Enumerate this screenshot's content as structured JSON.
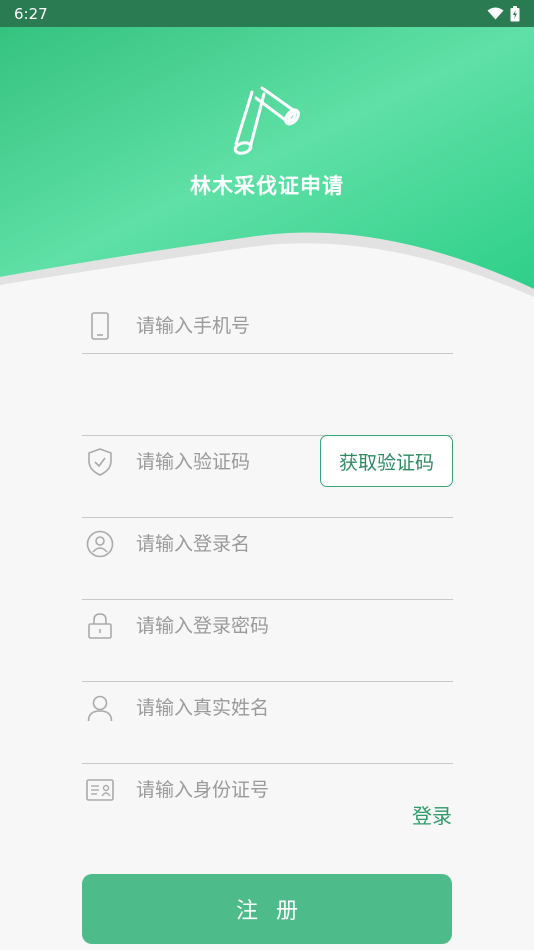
{
  "status_bar": {
    "time": "6:27"
  },
  "header": {
    "app_title": "林木采伐证申请",
    "logo_icon": "logs-icon"
  },
  "form": {
    "phone": {
      "placeholder": "请输入手机号",
      "icon": "phone-icon"
    },
    "code": {
      "placeholder": "请输入验证码",
      "icon": "shield-icon",
      "button_label": "获取验证码"
    },
    "username": {
      "placeholder": "请输入登录名",
      "icon": "user-circle-icon"
    },
    "password": {
      "placeholder": "请输入登录密码",
      "icon": "lock-icon"
    },
    "realname": {
      "placeholder": "请输入真实姓名",
      "icon": "person-icon"
    },
    "idcard": {
      "placeholder": "请输入身份证号",
      "icon": "id-card-icon"
    }
  },
  "login_link": "登录",
  "register_button": "注册",
  "colors": {
    "status_bar": "#2a7a52",
    "header_gradient_start": "#35c27f",
    "header_gradient_end": "#5fe0a6",
    "accent": "#2f9a6a",
    "primary_button": "#4dbb8a",
    "background": "#f7f7f7"
  }
}
